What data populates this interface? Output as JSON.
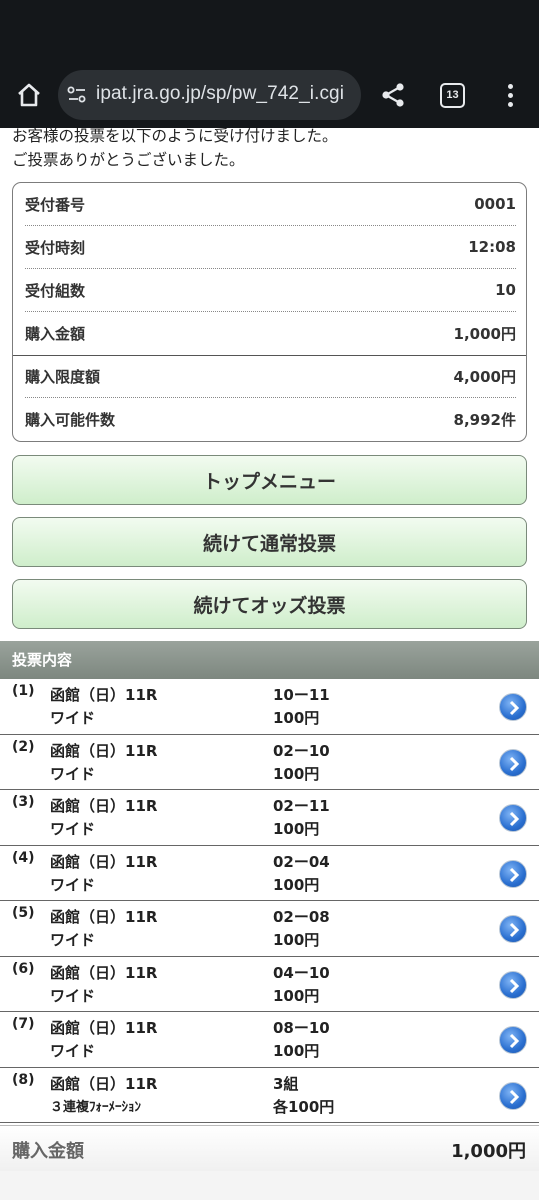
{
  "browser": {
    "url": "ipat.jra.go.jp/sp/pw_742_i.cgi",
    "tab_count": "13"
  },
  "intro": {
    "line1": "お客様の投票を以下のように受け付けました。",
    "line2": "ご投票ありがとうございました。"
  },
  "receipt": [
    {
      "label": "受付番号",
      "value": "0001"
    },
    {
      "label": "受付時刻",
      "value": "12:08"
    },
    {
      "label": "受付組数",
      "value": "10"
    },
    {
      "label": "購入金額",
      "value": "1,000円"
    },
    {
      "label": "購入限度額",
      "value": "4,000円"
    },
    {
      "label": "購入可能件数",
      "value": "8,992件"
    }
  ],
  "buttons": {
    "top_menu": "トップメニュー",
    "continue_normal": "続けて通常投票",
    "continue_odds": "続けてオッズ投票"
  },
  "bets_header": "投票内容",
  "bets": [
    {
      "num": "(1)",
      "race": "函館（日）11R",
      "type": "ワイド",
      "combo": "10ー11",
      "amount": "100円"
    },
    {
      "num": "(2)",
      "race": "函館（日）11R",
      "type": "ワイド",
      "combo": "02ー10",
      "amount": "100円"
    },
    {
      "num": "(3)",
      "race": "函館（日）11R",
      "type": "ワイド",
      "combo": "02ー11",
      "amount": "100円"
    },
    {
      "num": "(4)",
      "race": "函館（日）11R",
      "type": "ワイド",
      "combo": "02ー04",
      "amount": "100円"
    },
    {
      "num": "(5)",
      "race": "函館（日）11R",
      "type": "ワイド",
      "combo": "02ー08",
      "amount": "100円"
    },
    {
      "num": "(6)",
      "race": "函館（日）11R",
      "type": "ワイド",
      "combo": "04ー10",
      "amount": "100円"
    },
    {
      "num": "(7)",
      "race": "函館（日）11R",
      "type": "ワイド",
      "combo": "08ー10",
      "amount": "100円"
    },
    {
      "num": "(8)",
      "race": "函館（日）11R",
      "type": "３連複ﾌｫｰﾒｰｼｮﾝ",
      "combo": "3組",
      "amount": "各100円"
    }
  ],
  "total": {
    "label": "購入金額",
    "value": "1,000円"
  },
  "colors": {
    "browser_bg": "#14171a",
    "button_green": "#cfeecb",
    "header_gray": "#8a938c",
    "arrow_blue": "#2a6fd0"
  }
}
